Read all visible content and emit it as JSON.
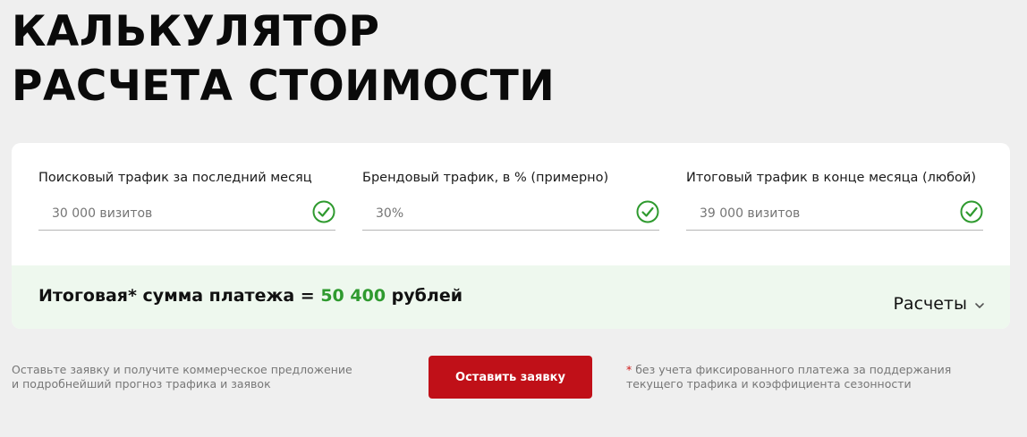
{
  "title": {
    "line1": "КАЛЬКУЛЯТОР",
    "line2": "РАСЧЕТА СТОИМОСТИ"
  },
  "fields": [
    {
      "label": "Поисковый трафик за последний месяц",
      "placeholder": "30 000 визитов",
      "icon": "check-circle-icon"
    },
    {
      "label": "Брендовый трафик, в % (примерно)",
      "placeholder": "30%",
      "icon": "check-circle-icon"
    },
    {
      "label": "Итоговый трафик в конце месяца (любой)",
      "placeholder": "39 000 визитов",
      "icon": "check-circle-icon"
    }
  ],
  "result": {
    "prefix": "Итоговая* сумма платежа = ",
    "amount": "50 400",
    "suffix": " рублей",
    "toggle_label": "Расчеты",
    "toggle_icon": "chevron-down-icon"
  },
  "footer": {
    "note_left_line1": "Оставьте заявку и получите коммерческое предложение",
    "note_left_line2": "и подробнейший прогноз трафика и заявок",
    "button_label": "Оставить заявку",
    "note_right_asterisk": "*",
    "note_right_line1": " без учета фиксированного платежа за поддержания",
    "note_right_line2": "текущего трафика и коэффициента сезонности"
  },
  "colors": {
    "accent_green": "#2f9a2f",
    "button_red": "#c01018",
    "result_bg": "#eef8ee",
    "page_bg": "#efefef"
  }
}
